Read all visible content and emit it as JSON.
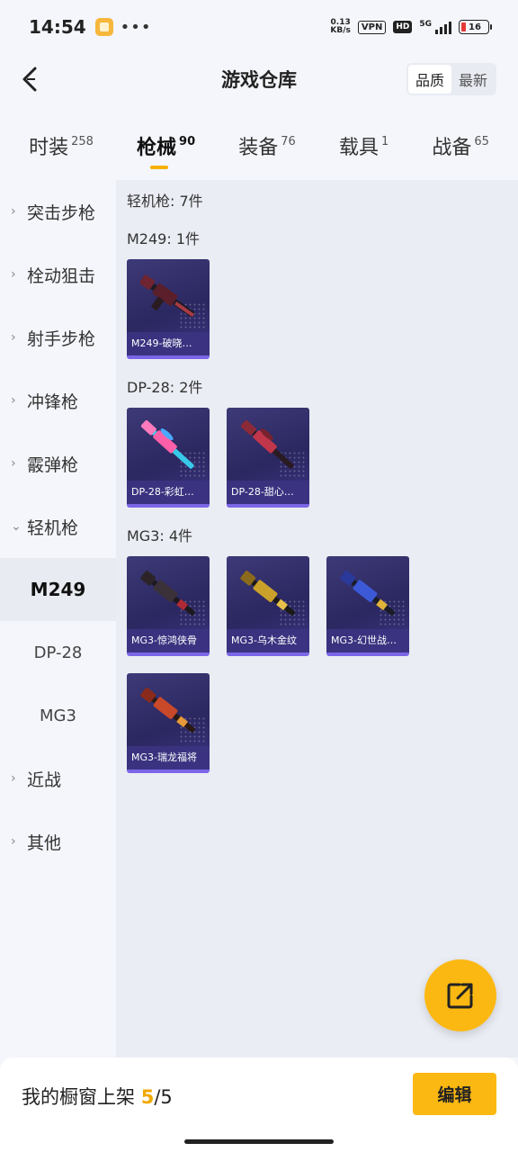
{
  "status_bar": {
    "time": "14:54",
    "dots": "•••",
    "net_speed_value": "0.13",
    "net_speed_unit": "KB/s",
    "vpn": "VPN",
    "hd": "HD",
    "network": "5G",
    "battery": "16"
  },
  "header": {
    "title": "游戏仓库",
    "sort_options": [
      "品质",
      "最新"
    ],
    "active_sort": "品质"
  },
  "tabs": [
    {
      "label": "时装",
      "count": "258"
    },
    {
      "label": "枪械",
      "count": "90"
    },
    {
      "label": "装备",
      "count": "76"
    },
    {
      "label": "载具",
      "count": "1"
    },
    {
      "label": "战备",
      "count": "65"
    }
  ],
  "sidebar": {
    "items": [
      "突击步枪",
      "栓动狙击",
      "射手步枪",
      "冲锋枪",
      "霰弹枪",
      "轻机枪"
    ],
    "sub_items": [
      "M249",
      "DP-28",
      "MG3"
    ],
    "more_items": [
      "近战",
      "其他"
    ]
  },
  "content": {
    "total": "轻机枪: 7件",
    "groups": [
      {
        "title": "M249: 1件",
        "items": [
          "M249-破晓…"
        ]
      },
      {
        "title": "DP-28: 2件",
        "items": [
          "DP-28-彩虹…",
          "DP-28-甜心…"
        ]
      },
      {
        "title": "MG3: 4件",
        "items": [
          "MG3-惊鸿侠骨",
          "MG3-乌木金纹",
          "MG3-幻世战…",
          "MG3-瑞龙福将"
        ]
      }
    ]
  },
  "bottom": {
    "label": "我的橱窗上架",
    "count": "5",
    "separator": "/",
    "total": "5",
    "edit": "编辑"
  },
  "colors": {
    "accent": "#fcb812",
    "card_bg": "#2b2760",
    "card_border": "#7a66e6"
  }
}
